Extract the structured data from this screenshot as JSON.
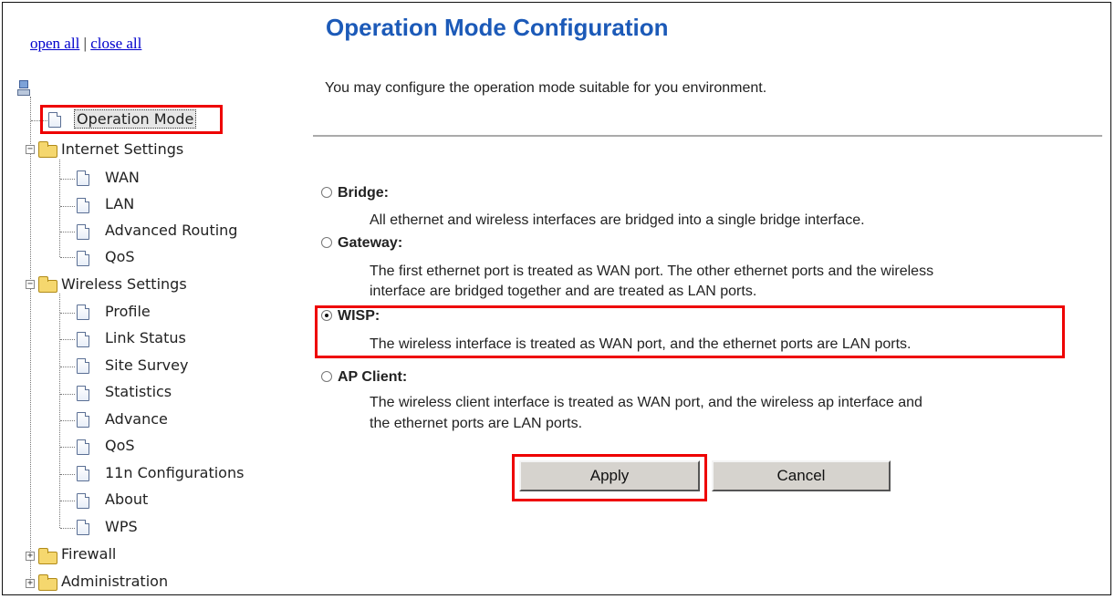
{
  "nav": {
    "open_all": "open all",
    "separator": "|",
    "close_all": "close all",
    "root_icon": "computer-icon",
    "items": [
      {
        "label": "Operation Mode",
        "type": "page",
        "selected": true
      },
      {
        "label": "Internet Settings",
        "type": "folder",
        "expanded": true
      },
      {
        "label": "WAN",
        "type": "page"
      },
      {
        "label": "LAN",
        "type": "page"
      },
      {
        "label": "Advanced Routing",
        "type": "page"
      },
      {
        "label": "QoS",
        "type": "page"
      },
      {
        "label": "Wireless Settings",
        "type": "folder",
        "expanded": true
      },
      {
        "label": "Profile",
        "type": "page"
      },
      {
        "label": "Link Status",
        "type": "page"
      },
      {
        "label": "Site Survey",
        "type": "page"
      },
      {
        "label": "Statistics",
        "type": "page"
      },
      {
        "label": "Advance",
        "type": "page"
      },
      {
        "label": "QoS",
        "type": "page"
      },
      {
        "label": "11n Configurations",
        "type": "page"
      },
      {
        "label": "About",
        "type": "page"
      },
      {
        "label": "WPS",
        "type": "page"
      },
      {
        "label": "Firewall",
        "type": "folder",
        "expanded": false
      },
      {
        "label": "Administration",
        "type": "folder",
        "expanded": false
      }
    ]
  },
  "main": {
    "title": "Operation Mode Configuration",
    "intro": "You may configure the operation mode suitable for you environment.",
    "options": [
      {
        "label": "Bridge:",
        "selected": false,
        "desc": [
          "All ethernet and wireless interfaces are bridged into a single bridge interface."
        ]
      },
      {
        "label": "Gateway:",
        "selected": false,
        "desc": [
          "The first ethernet port is treated as WAN port. The other ethernet ports and the wireless",
          "interface are bridged together and are treated as LAN ports."
        ]
      },
      {
        "label": "WISP:",
        "selected": true,
        "desc": [
          "The wireless interface is treated as WAN port, and the ethernet ports are LAN ports."
        ]
      },
      {
        "label": "AP Client:",
        "selected": false,
        "desc": [
          "The wireless client interface is treated as WAN port, and the wireless ap interface and",
          "the ethernet ports are LAN ports."
        ]
      }
    ],
    "apply_label": "Apply",
    "cancel_label": "Cancel"
  },
  "colors": {
    "title": "#1c5ab8",
    "highlight": "#e00000",
    "link": "#0000cc"
  }
}
